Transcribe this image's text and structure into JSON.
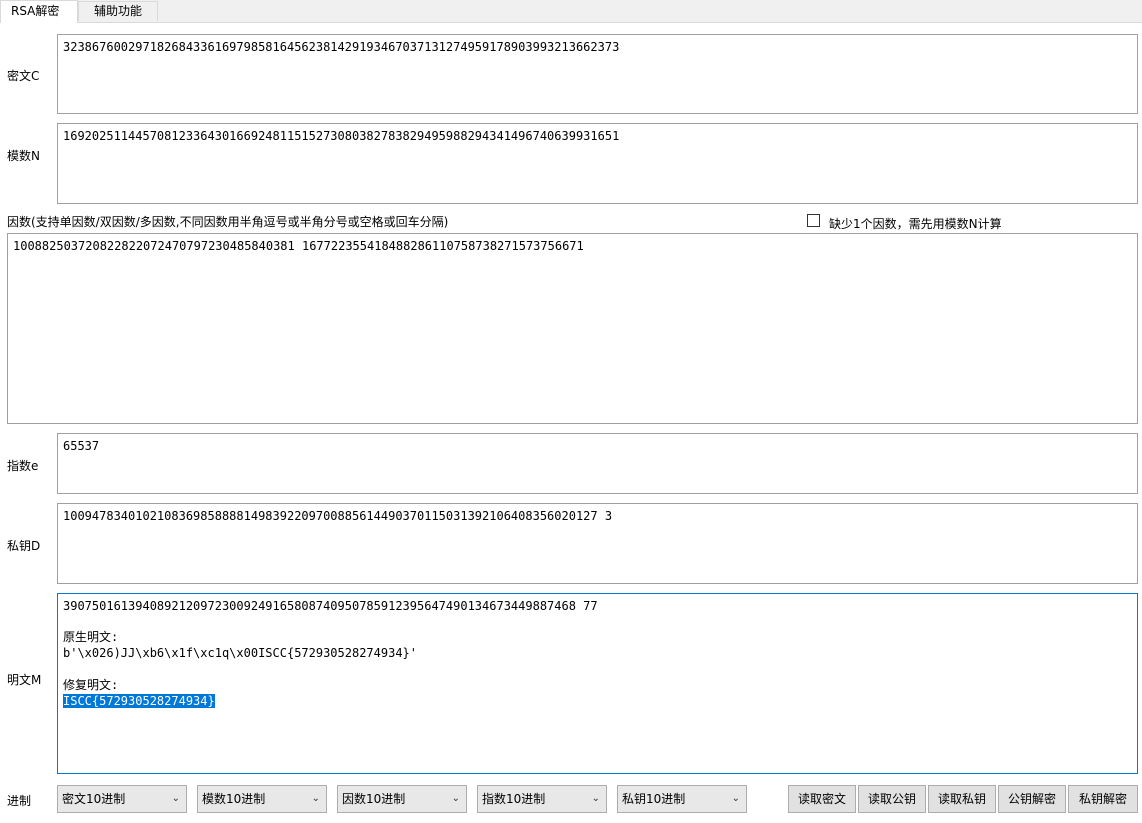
{
  "tabs": [
    {
      "label": "RSA解密"
    },
    {
      "label": "辅助功能"
    }
  ],
  "fields": {
    "ciphertext": {
      "label": "密文C",
      "value": "32386760029718268433616979858164562381429193467037131274959178903993213662373"
    },
    "modulus": {
      "label": "模数N",
      "value": "16920251144570812336430166924811515273080382783829495988294341496740639931651"
    },
    "factors": {
      "label": "因数(支持单因数/双因数/多因数,不同因数用半角逗号或半角分号或空格或回车分隔)",
      "value": "100882503720822822072470797230485840381 167722355418488286110758738271573756671",
      "missing_checkbox_label": "缺少1个因数，需先用模数N计算",
      "missing_checked": false
    },
    "exponent": {
      "label": "指数e",
      "value": "65537"
    },
    "private_key": {
      "label": "私钥D",
      "value": "10094783401021083698588881498392209700885614490370115031392106408356020127 3"
    },
    "plaintext": {
      "label": "明文M",
      "value_line1": "39075016139408921209723009249165808740950785912395647490134673449887468 77",
      "raw_label": "原生明文:",
      "raw_value": "b'\\x026)JJ\\xb6\\x1f\\xc1q\\x00ISCC{572930528274934}'",
      "fixed_label": "修复明文:",
      "fixed_value": "ISCC{572930528274934}"
    }
  },
  "base": {
    "label": "进制",
    "selects": [
      {
        "value": "密文10进制"
      },
      {
        "value": "模数10进制"
      },
      {
        "value": "因数10进制"
      },
      {
        "value": "指数10进制"
      },
      {
        "value": "私钥10进制"
      }
    ]
  },
  "buttons": [
    {
      "label": "读取密文"
    },
    {
      "label": "读取公钥"
    },
    {
      "label": "读取私钥"
    },
    {
      "label": "公钥解密"
    },
    {
      "label": "私钥解密"
    }
  ],
  "icons": {
    "dropdown": "chevron-down-icon"
  }
}
